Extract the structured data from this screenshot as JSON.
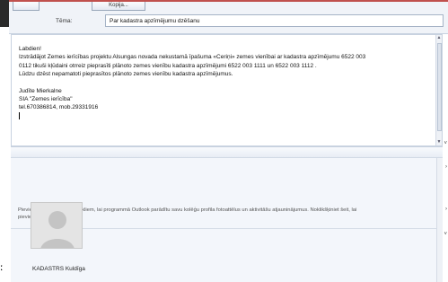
{
  "header": {
    "copy_button_label": "Kopija...",
    "subject_label": "Tēma:",
    "subject_value": "Par kadastra apzīmējumu dzēšanu"
  },
  "body": {
    "greeting": "Labdien!",
    "line1": "Izstrādājot  Zemes ierīcības projektu Alsungas novada nekustamā īpašuma «Ceriņi» zemes vienībai ar kadastra apzīmējumu 6522 003",
    "line2": "0112  tikuši kļūdaini otrreiz pieprasīti plānoto zemes vienību kadastra apzīmējumi 6522 003 1111 un  6522 003 1112 .",
    "line3": "Lūdzu dzēst nepamatoti pieprasītos plānoto zemes vienību kadastra apzīmējumus.",
    "sig_name": "Judīte Mierkalne",
    "sig_company": "SIA \"Zemes ierīcība\"",
    "sig_phone": "tel.670386814, mob.29331916"
  },
  "social": {
    "info_line1": "Pievienolanās sociālajiem tīkliem, lai programmā Outlook parādītu savu kolēģu profila fotoattēlus un aktivitāšu atjauninājumus. Noklikšķiniet šeit, lai",
    "info_line2": "pievienotu tīklus.",
    "profile_name": "KADASTRS Kuldīga"
  },
  "icons": {
    "scroll_up": "scroll-up-arrow-icon",
    "scroll_down": "scroll-down-arrow-icon",
    "expand": "chevron-right-icon",
    "collapse": "chevron-down-icon"
  },
  "colors": {
    "accent_red": "#c0504d",
    "pane_background": "#f3f6fb"
  }
}
